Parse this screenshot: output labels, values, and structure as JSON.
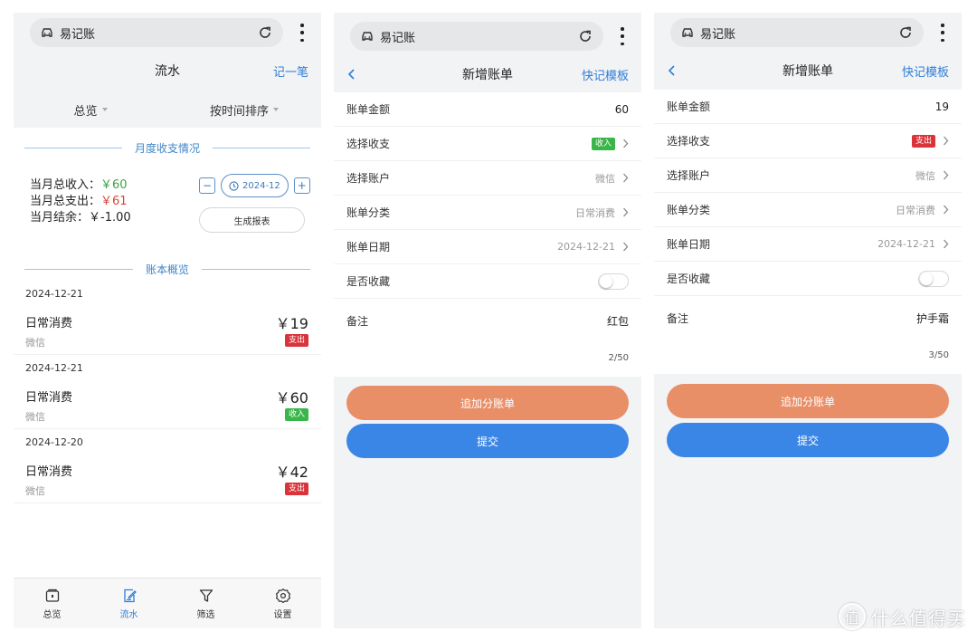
{
  "browser": {
    "title": "易记账"
  },
  "screen1": {
    "header": {
      "title": "流水",
      "action": "记一笔"
    },
    "filters": {
      "overview": "总览",
      "sort": "按时间排序"
    },
    "monthly": {
      "section_title": "月度收支情况",
      "income_label": "当月总收入：",
      "income_value": "￥60",
      "expense_label": "当月总支出：",
      "expense_value": "￥61",
      "balance_label": "当月结余：",
      "balance_value": "￥-1.00",
      "month": "2024-12",
      "minus": "−",
      "plus": "+",
      "report_button": "生成报表"
    },
    "ledger_title": "账本概览",
    "entries": [
      {
        "date": "2024-12-21",
        "category": "日常消费",
        "account": "微信",
        "amount": "￥19",
        "type": "支出"
      },
      {
        "date": "2024-12-21",
        "category": "日常消费",
        "account": "微信",
        "amount": "￥60",
        "type": "收入"
      },
      {
        "date": "2024-12-20",
        "category": "日常消费",
        "account": "微信",
        "amount": "￥42",
        "type": "支出"
      }
    ],
    "tabs": [
      {
        "label": "总览",
        "icon": "wallet-icon"
      },
      {
        "label": "流水",
        "icon": "edit-icon"
      },
      {
        "label": "筛选",
        "icon": "filter-icon"
      },
      {
        "label": "设置",
        "icon": "gear-icon"
      }
    ]
  },
  "screen2": {
    "header": {
      "title": "新增账单",
      "action": "快记模板"
    },
    "fields": {
      "amount_label": "账单金额",
      "amount_value": "60",
      "type_label": "选择收支",
      "type_value": "收入",
      "account_label": "选择账户",
      "account_value": "微信",
      "category_label": "账单分类",
      "category_value": "日常消费",
      "date_label": "账单日期",
      "date_value": "2024-12-21",
      "favorite_label": "是否收藏",
      "note_label": "备注",
      "note_value": "红包",
      "counter": "2/50"
    },
    "buttons": {
      "add_split": "追加分账单",
      "submit": "提交"
    }
  },
  "screen3": {
    "header": {
      "title": "新增账单",
      "action": "快记模板"
    },
    "fields": {
      "amount_label": "账单金额",
      "amount_value": "19",
      "type_label": "选择收支",
      "type_value": "支出",
      "account_label": "选择账户",
      "account_value": "微信",
      "category_label": "账单分类",
      "category_value": "日常消费",
      "date_label": "账单日期",
      "date_value": "2024-12-21",
      "favorite_label": "是否收藏",
      "note_label": "备注",
      "note_value": "护手霜",
      "counter": "3/50"
    },
    "buttons": {
      "add_split": "追加分账单",
      "submit": "提交"
    }
  },
  "watermark": {
    "text": "什么值得买",
    "icon_char": "值"
  },
  "colors": {
    "accent": "#2f7ed8",
    "income": "#3ab54a",
    "expense": "#d9343a",
    "orange_button": "#e98f68",
    "blue_button": "#3a86e6"
  }
}
